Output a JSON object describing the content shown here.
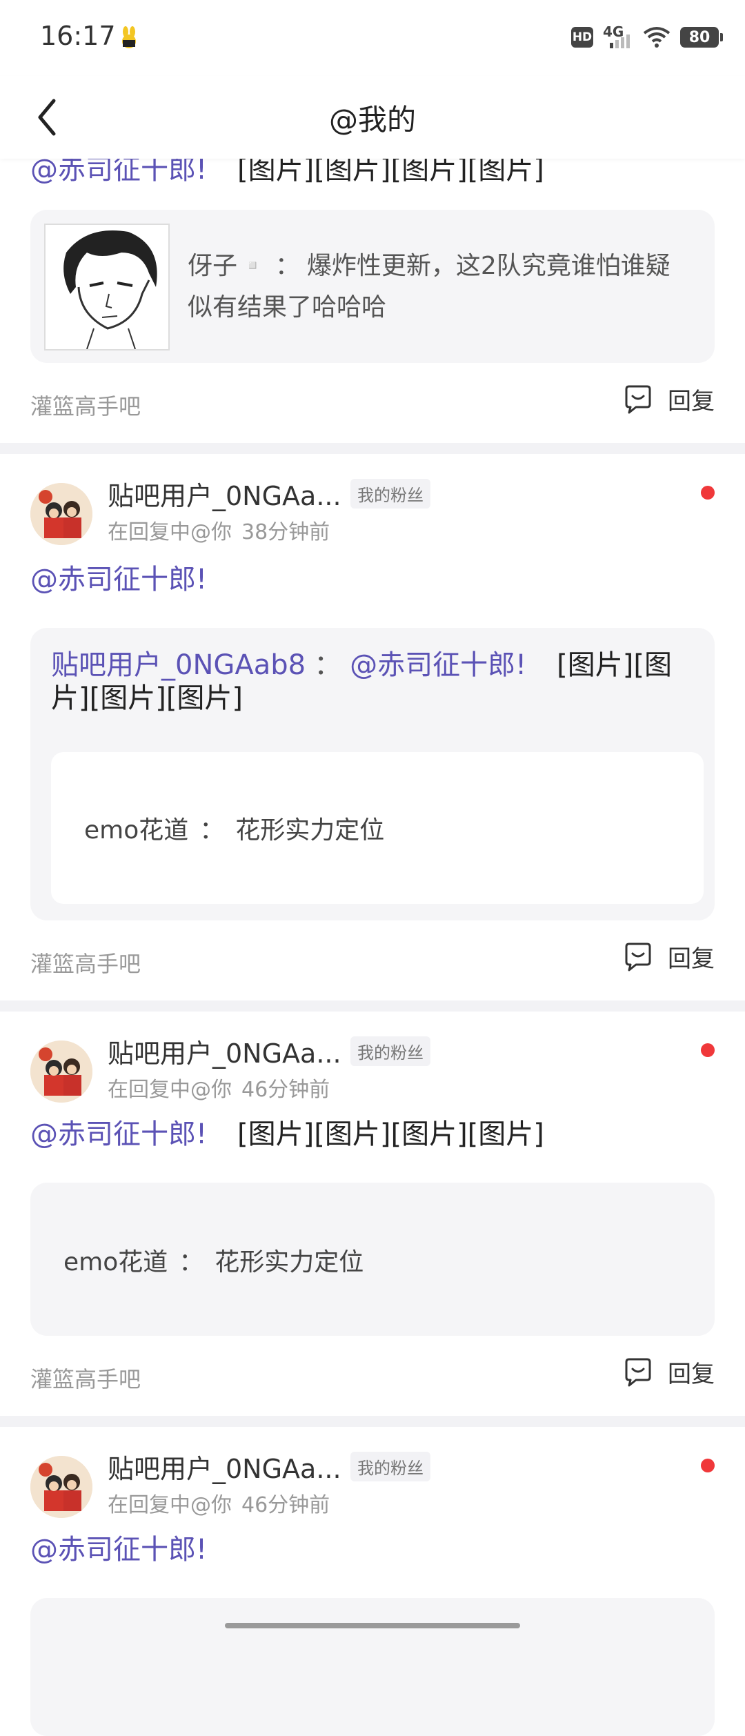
{
  "status_bar": {
    "time": "16:17",
    "hd": "HD",
    "network": "4G",
    "battery": "80"
  },
  "nav": {
    "title": "@我的"
  },
  "items": [
    {
      "mention": "@赤司征十郎!",
      "images_text": "[图片][图片][图片][图片]",
      "quote": {
        "author": "伢子▫️",
        "sep": "：",
        "text": "爆炸性更新，这2队究竟谁怕谁疑似有结果了哈哈哈"
      },
      "forum": "灌篮高手吧",
      "reply_label": "回复"
    },
    {
      "user": "贴吧用户_0NGAa...",
      "badge": "我的粉丝",
      "meta_prefix": "在回复中@你",
      "time": "38分钟前",
      "mention": "@赤司征十郎!",
      "quote": {
        "author": "贴吧用户_0NGAab8",
        "sep": "：",
        "mention": "@赤司征十郎!",
        "images_line1": "[图片][图",
        "images_line2": "片][图片][图片]",
        "inner_author": "emo花道",
        "inner_sep": "：",
        "inner_text": "花形实力定位"
      },
      "forum": "灌篮高手吧",
      "reply_label": "回复"
    },
    {
      "user": "贴吧用户_0NGAa...",
      "badge": "我的粉丝",
      "meta_prefix": "在回复中@你",
      "time": "46分钟前",
      "mention": "@赤司征十郎!",
      "images_text": "[图片][图片][图片][图片]",
      "quote": {
        "author": "emo花道",
        "sep": "：",
        "text": "花形实力定位"
      },
      "forum": "灌篮高手吧",
      "reply_label": "回复"
    },
    {
      "user": "贴吧用户_0NGAa...",
      "badge": "我的粉丝",
      "meta_prefix": "在回复中@你",
      "time": "46分钟前",
      "mention": "@赤司征十郎!"
    }
  ],
  "colors": {
    "mention": "#5b52b5",
    "unread_dot": "#f0383a",
    "quote_bg": "#f5f5f7"
  },
  "icons": [
    "back-arrow-icon",
    "reply-bubble-icon",
    "unread-dot-icon"
  ]
}
